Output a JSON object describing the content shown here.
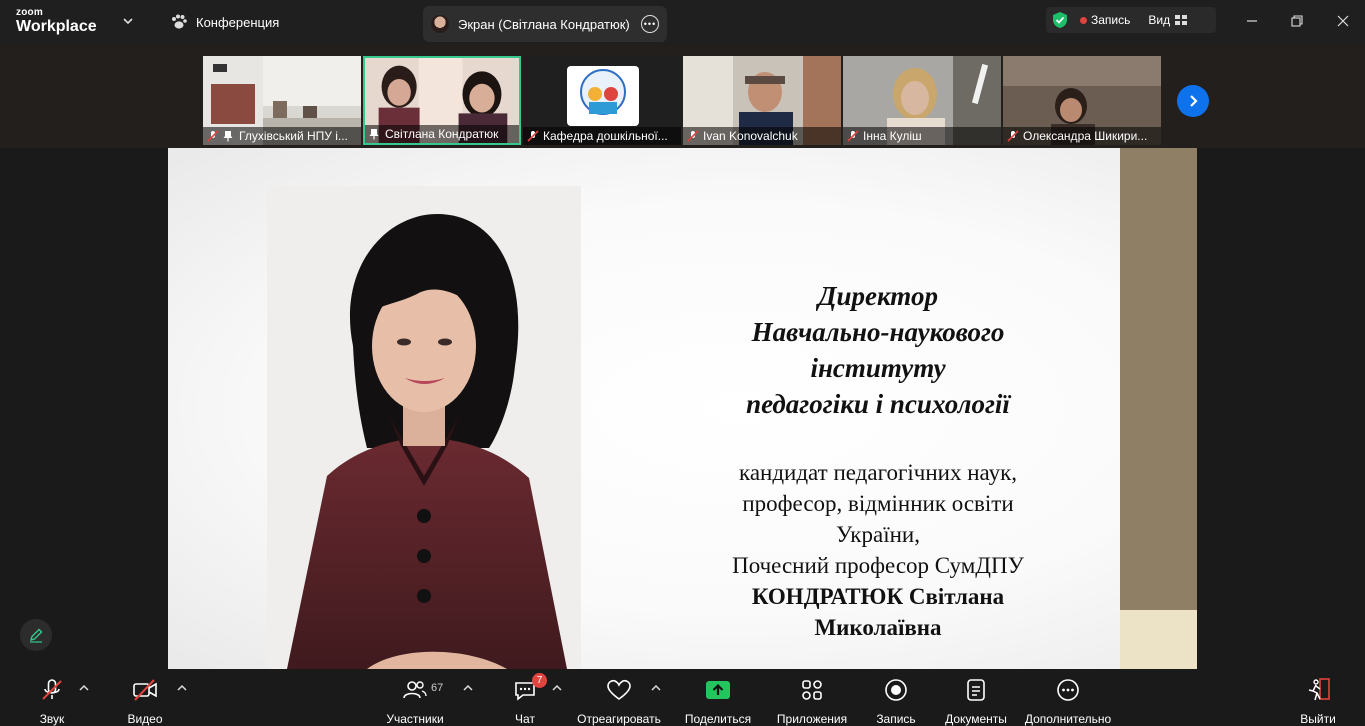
{
  "app": {
    "logo_top": "zoom",
    "logo_bottom": "Workplace"
  },
  "titlebar": {
    "conference_label": "Конференция",
    "screen_tab_label": "Экран (Світлана Кондратюк)",
    "record_label": "Запись",
    "view_label": "Вид"
  },
  "participants": [
    {
      "name": "Глухівський НПУ і...",
      "muted": true,
      "pinned": true
    },
    {
      "name": "Світлана Кондратюк",
      "muted": false,
      "pinned": true
    },
    {
      "name": "Кафедра дошкільної...",
      "muted": true,
      "pinned": false
    },
    {
      "name": "Ivan Konovalchuk",
      "muted": true,
      "pinned": false
    },
    {
      "name": "Інна Куліш",
      "muted": true,
      "pinned": false
    },
    {
      "name": "Олександра Шикири...",
      "muted": true,
      "pinned": false
    }
  ],
  "slide": {
    "title_lines": [
      "Директор",
      "Навчально-наукового",
      "інституту",
      "педагогіки і психології"
    ],
    "desc_lines": [
      "кандидат педагогічних наук,",
      "професор, відмінник освіти",
      "України,",
      "Почесний професор СумДПУ"
    ],
    "name_lines": [
      "КОНДРАТЮК Світлана",
      "Миколаївна"
    ]
  },
  "toolbar": {
    "audio": "Звук",
    "video": "Видео",
    "participants": "Участники",
    "participants_count": "67",
    "chat": "Чат",
    "chat_badge": "7",
    "react": "Отреагировать",
    "share": "Поделиться",
    "apps": "Приложения",
    "record": "Запись",
    "docs": "Документы",
    "more": "Дополнительно",
    "leave": "Выйти"
  },
  "colors": {
    "accent": "#0e72ed",
    "active_border": "#35c98d",
    "record_red": "#e0443e",
    "share_green": "#22c55e"
  }
}
